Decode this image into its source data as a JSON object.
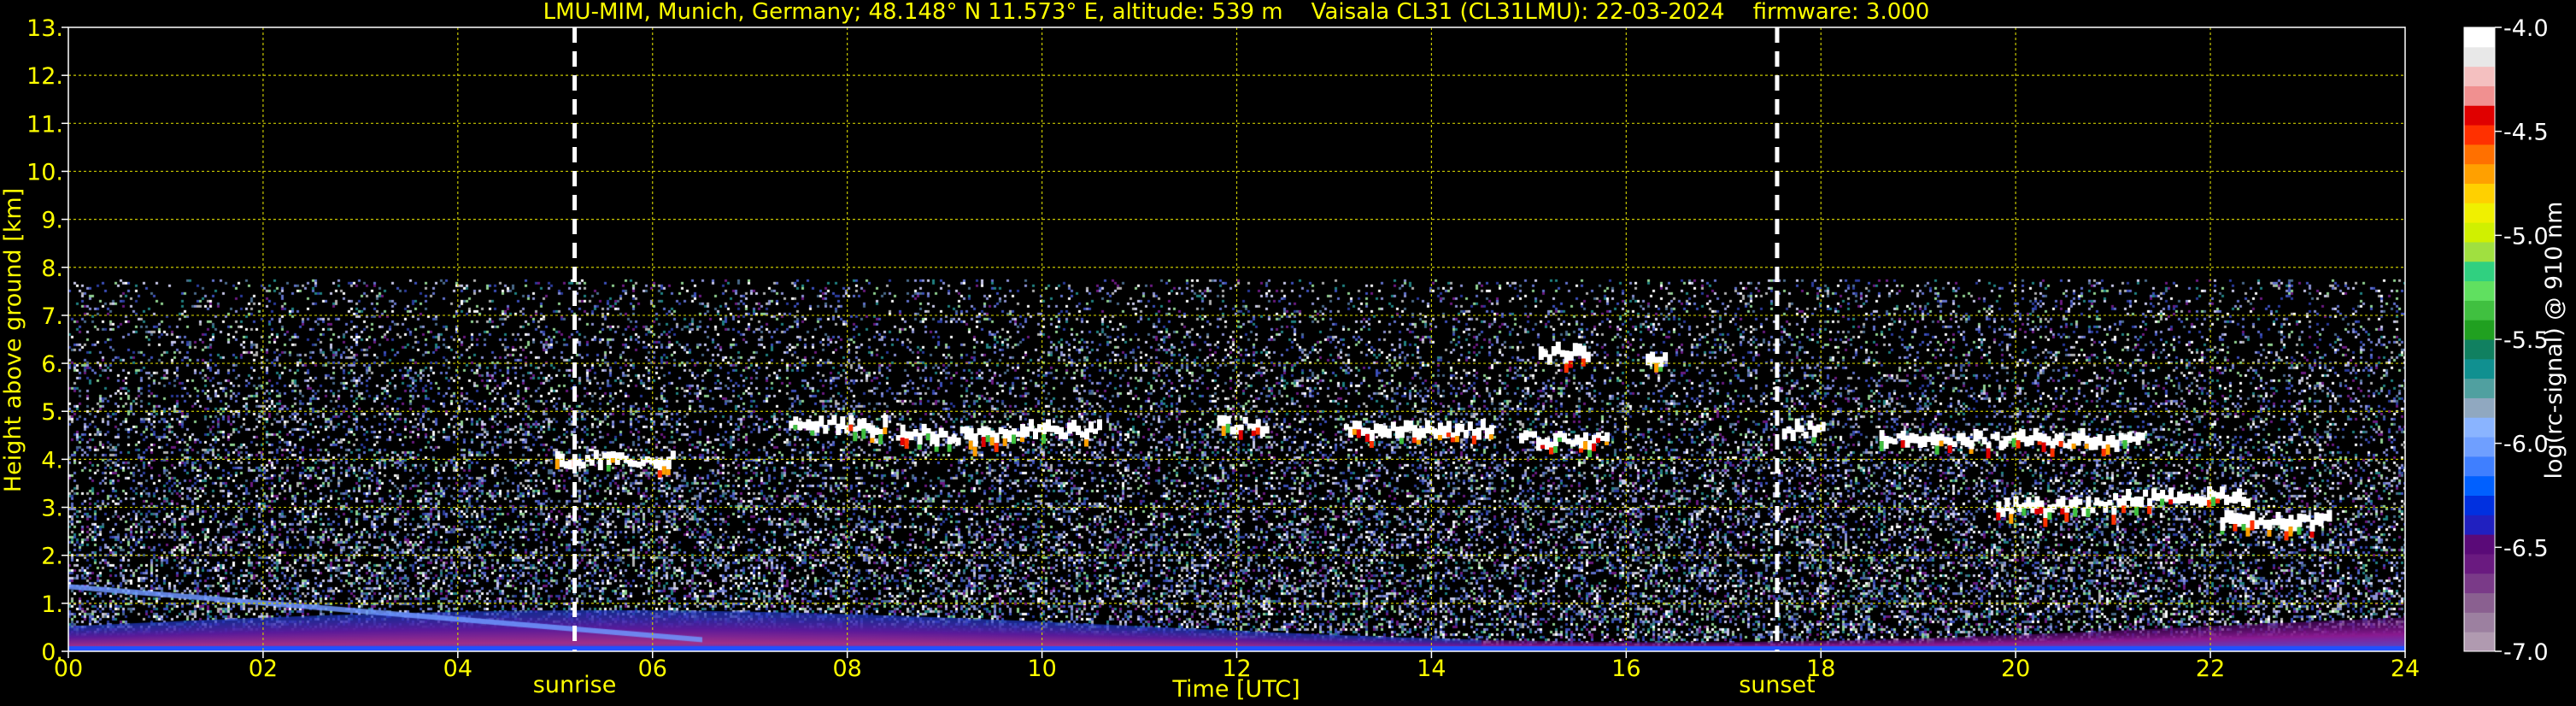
{
  "chart_data": {
    "type": "heatmap",
    "title": "LMU-MIM, Munich, Germany; 48.148° N 11.573° E, altitude: 539 m    Vaisala CL31 (CL31LMU): 22-03-2024    firmware: 3.000",
    "xlabel": "Time [UTC]",
    "ylabel": "Height above ground [km]",
    "xlim": [
      0,
      24
    ],
    "ylim": [
      0,
      13
    ],
    "x_ticks": [
      {
        "v": 0,
        "label": "00"
      },
      {
        "v": 2,
        "label": "02"
      },
      {
        "v": 4,
        "label": "04"
      },
      {
        "v": 6,
        "label": "06"
      },
      {
        "v": 8,
        "label": "08"
      },
      {
        "v": 10,
        "label": "10"
      },
      {
        "v": 12,
        "label": "12"
      },
      {
        "v": 14,
        "label": "14"
      },
      {
        "v": 16,
        "label": "16"
      },
      {
        "v": 18,
        "label": "18"
      },
      {
        "v": 20,
        "label": "20"
      },
      {
        "v": 22,
        "label": "22"
      },
      {
        "v": 24,
        "label": "24"
      }
    ],
    "y_ticks": [
      {
        "v": 0,
        "label": "0."
      },
      {
        "v": 1,
        "label": "1."
      },
      {
        "v": 2,
        "label": "2."
      },
      {
        "v": 3,
        "label": "3."
      },
      {
        "v": 4,
        "label": "4."
      },
      {
        "v": 5,
        "label": "5."
      },
      {
        "v": 6,
        "label": "6."
      },
      {
        "v": 7,
        "label": "7."
      },
      {
        "v": 8,
        "label": "8."
      },
      {
        "v": 9,
        "label": "9."
      },
      {
        "v": 10,
        "label": "10."
      },
      {
        "v": 11,
        "label": "11."
      },
      {
        "v": 12,
        "label": "12."
      },
      {
        "v": 13,
        "label": "13."
      }
    ],
    "grid": true,
    "grid_color": "#c8c800",
    "text_color": "#ffff00",
    "signal_top_km": 7.75,
    "markers": [
      {
        "name": "sunrise",
        "time": 5.2,
        "label": "sunrise"
      },
      {
        "name": "sunset",
        "time": 17.55,
        "label": "sunset"
      }
    ],
    "clouds": [
      {
        "t0": 5.0,
        "t1": 6.2,
        "h": 4.0
      },
      {
        "t0": 7.4,
        "t1": 8.4,
        "h": 4.7
      },
      {
        "t0": 8.5,
        "t1": 9.6,
        "h": 4.5
      },
      {
        "t0": 9.6,
        "t1": 10.6,
        "h": 4.6
      },
      {
        "t0": 11.8,
        "t1": 12.3,
        "h": 4.7
      },
      {
        "t0": 13.1,
        "t1": 14.6,
        "h": 4.6
      },
      {
        "t0": 14.9,
        "t1": 15.8,
        "h": 4.4
      },
      {
        "t0": 15.1,
        "t1": 15.6,
        "h": 6.2
      },
      {
        "t0": 16.2,
        "t1": 16.4,
        "h": 6.1
      },
      {
        "t0": 17.6,
        "t1": 18.0,
        "h": 4.6
      },
      {
        "t0": 18.6,
        "t1": 21.3,
        "h": 4.4
      },
      {
        "t0": 19.8,
        "t1": 21.0,
        "h": 3.0
      },
      {
        "t0": 21.0,
        "t1": 22.4,
        "h": 3.2
      },
      {
        "t0": 22.1,
        "t1": 23.2,
        "h": 2.7
      }
    ],
    "colorbar": {
      "label": "log(rc-signal) @ 910 nm",
      "range": [
        -7.0,
        -4.0
      ],
      "ticks": [
        {
          "v": -4.0,
          "label": "-4.0"
        },
        {
          "v": -4.5,
          "label": "-4.5"
        },
        {
          "v": -5.0,
          "label": "-5.0"
        },
        {
          "v": -5.5,
          "label": "-5.5"
        },
        {
          "v": -6.0,
          "label": "-6.0"
        },
        {
          "v": -6.5,
          "label": "-6.5"
        },
        {
          "v": -7.0,
          "label": "-7.0"
        }
      ],
      "colors": [
        "#b09ab0",
        "#9c80a0",
        "#8a6090",
        "#7a3a88",
        "#6a1a80",
        "#5a0a78",
        "#2020c0",
        "#0030e0",
        "#0060ff",
        "#3f7fff",
        "#6f9fff",
        "#8ab4ff",
        "#90a8c0",
        "#50a0a0",
        "#109090",
        "#108060",
        "#20a020",
        "#40c040",
        "#60e060",
        "#30d080",
        "#a0e040",
        "#d0f000",
        "#f0f000",
        "#ffd000",
        "#ffa000",
        "#ff7000",
        "#ff3000",
        "#e00000",
        "#f09090",
        "#f4c0c0",
        "#e8e8e8",
        "#ffffff"
      ]
    }
  }
}
